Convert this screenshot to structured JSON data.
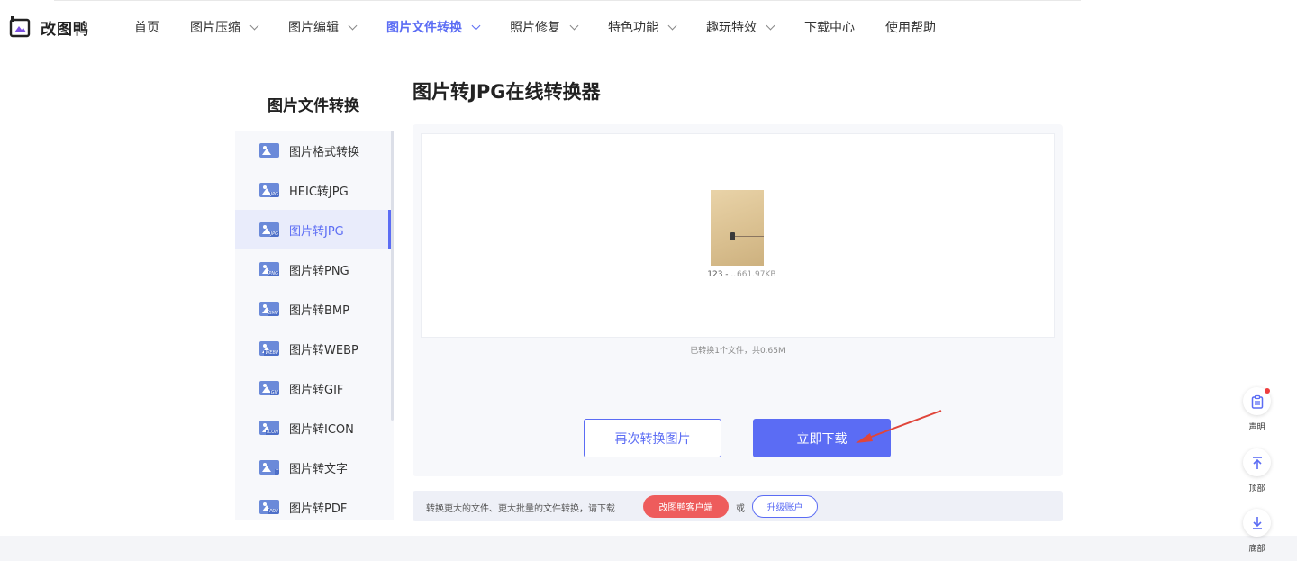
{
  "brand": {
    "name": "改图鸭",
    "accent": "#5b6cf4"
  },
  "nav": {
    "items": [
      {
        "label": "首页",
        "has_menu": false,
        "active": false
      },
      {
        "label": "图片压缩",
        "has_menu": true,
        "active": false
      },
      {
        "label": "图片编辑",
        "has_menu": true,
        "active": false
      },
      {
        "label": "图片文件转换",
        "has_menu": true,
        "active": true
      },
      {
        "label": "照片修复",
        "has_menu": true,
        "active": false
      },
      {
        "label": "特色功能",
        "has_menu": true,
        "active": false
      },
      {
        "label": "趣玩特效",
        "has_menu": true,
        "active": false
      },
      {
        "label": "下载中心",
        "has_menu": false,
        "active": false
      },
      {
        "label": "使用帮助",
        "has_menu": false,
        "active": false
      }
    ]
  },
  "sidebar": {
    "title": "图片文件转换",
    "items": [
      {
        "label": "图片格式转换",
        "icon": "image-convert-icon",
        "tag": ""
      },
      {
        "label": "HEIC转JPG",
        "icon": "heic-icon",
        "tag": "JPG"
      },
      {
        "label": "图片转JPG",
        "icon": "jpg-icon",
        "tag": "JPG",
        "active": true
      },
      {
        "label": "图片转PNG",
        "icon": "png-icon",
        "tag": "PNG"
      },
      {
        "label": "图片转BMP",
        "icon": "bmp-icon",
        "tag": "BMP"
      },
      {
        "label": "图片转WEBP",
        "icon": "webp-icon",
        "tag": "WEBP"
      },
      {
        "label": "图片转GIF",
        "icon": "gif-icon",
        "tag": "GIF"
      },
      {
        "label": "图片转ICON",
        "icon": "icon-format-icon",
        "tag": "ICON"
      },
      {
        "label": "图片转文字",
        "icon": "text-icon",
        "tag": "T"
      },
      {
        "label": "图片转PDF",
        "icon": "pdf-icon",
        "tag": "PDF"
      }
    ]
  },
  "main": {
    "title": "图片转JPG在线转换器",
    "file": {
      "name": "123 - ...",
      "size": "661.97KB"
    },
    "summary": "已转换1个文件，共0.65M",
    "again_label": "再次转换图片",
    "download_label": "立即下载"
  },
  "promo": {
    "text": "转换更大的文件、更大批量的文件转换，请下载",
    "client_label": "改图鸭客户端",
    "or": "或",
    "upgrade_label": "升级账户"
  },
  "tools": {
    "statement": "声明",
    "top": "顶部",
    "bottom": "底部"
  },
  "colors": {
    "annotation_arrow": "#e0453a",
    "promo_red": "#ee5c5c"
  }
}
